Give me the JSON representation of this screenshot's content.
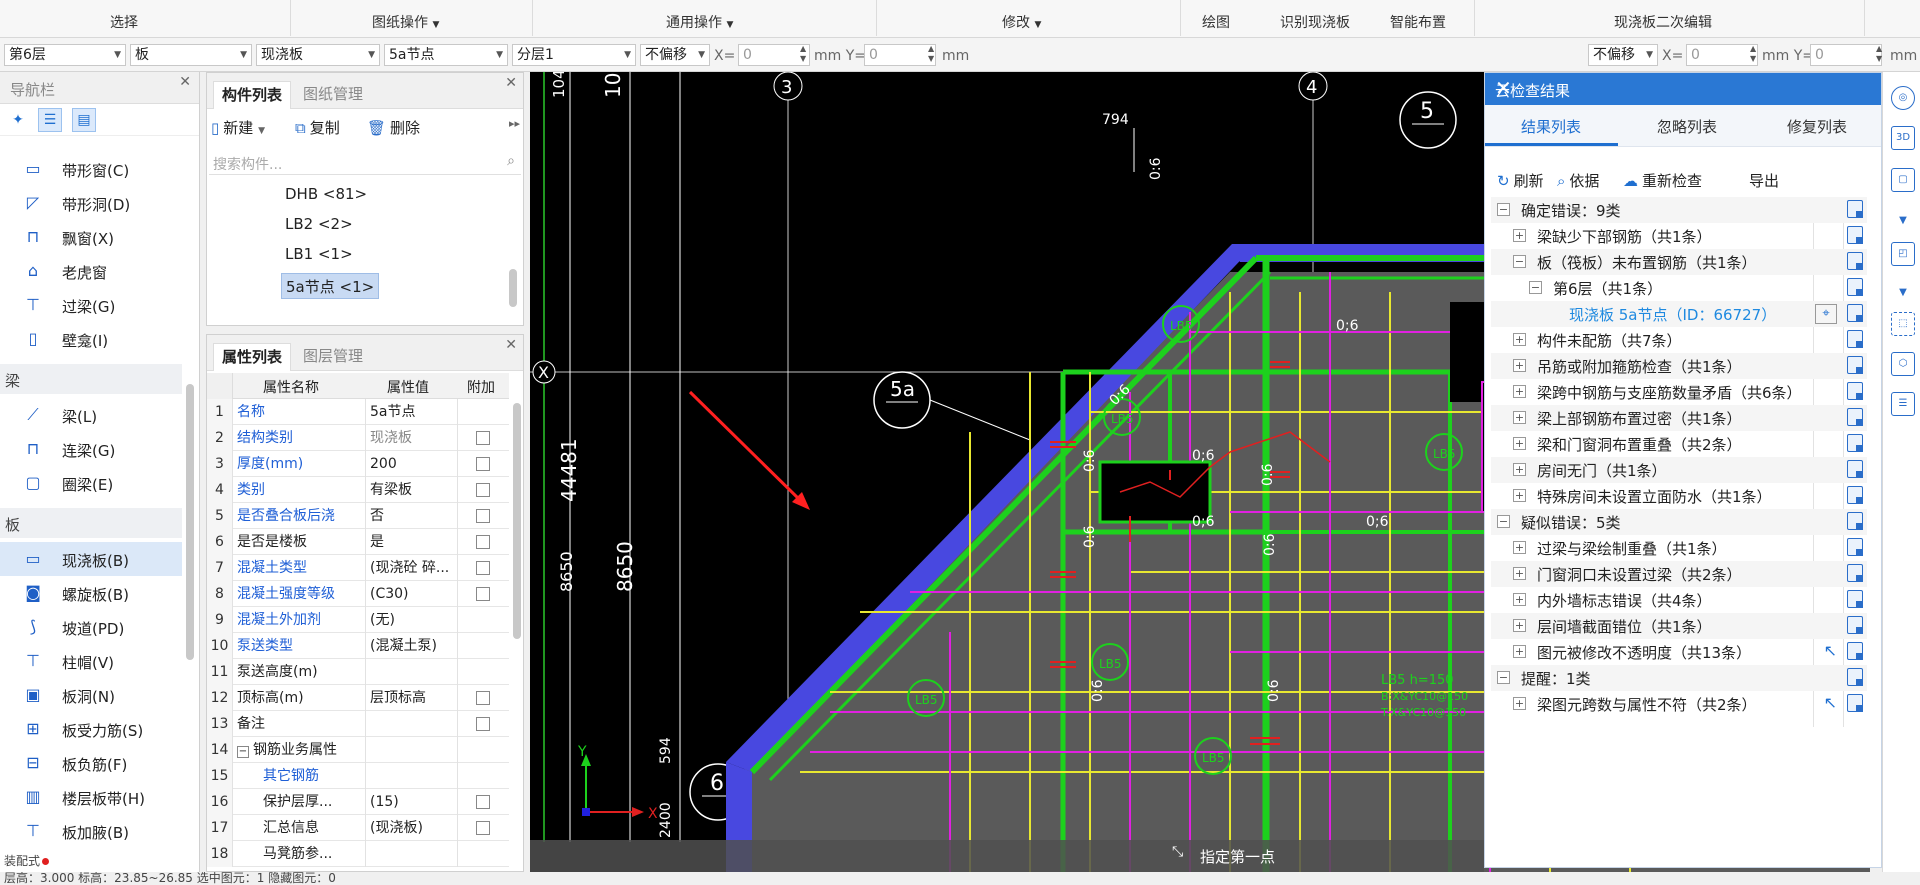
{
  "ribbon": {
    "groups": [
      "选择",
      "图纸操作",
      "通用操作",
      "修改",
      "绘图",
      "识别现浇板",
      "智能布置",
      "现浇板二次编辑"
    ]
  },
  "toolbar2": {
    "floor": "第6层",
    "category": "板",
    "type": "现浇板",
    "component": "5a节点",
    "layer": "分层1",
    "offset_left": "不偏移",
    "x_label_left": "X=",
    "x_value_left": "0",
    "y_label_left": "mm Y=",
    "y_value_left": "0",
    "unit_left": "mm",
    "offset_right": "不偏移",
    "x_label_right": "X=",
    "x_value_right": "0",
    "y_label_right": "mm Y=",
    "y_value_right": "0",
    "unit_right": "mm"
  },
  "nav": {
    "title": "导航栏",
    "items_top": [
      {
        "label": "带形窗(C)",
        "icon": "strip-window-icon"
      },
      {
        "label": "带形洞(D)",
        "icon": "strip-hole-icon"
      },
      {
        "label": "飘窗(X)",
        "icon": "bay-window-icon"
      },
      {
        "label": "老虎窗",
        "icon": "dormer-icon"
      },
      {
        "label": "过梁(G)",
        "icon": "lintel-icon"
      },
      {
        "label": "壁龛(I)",
        "icon": "niche-icon"
      }
    ],
    "cat_beam": "梁",
    "items_beam": [
      {
        "label": "梁(L)",
        "icon": "beam-icon"
      },
      {
        "label": "连梁(G)",
        "icon": "link-beam-icon"
      },
      {
        "label": "圈梁(E)",
        "icon": "ring-beam-icon"
      }
    ],
    "cat_slab": "板",
    "items_slab": [
      {
        "label": "现浇板(B)",
        "icon": "cast-slab-icon"
      },
      {
        "label": "螺旋板(B)",
        "icon": "spiral-slab-icon"
      },
      {
        "label": "坡道(PD)",
        "icon": "ramp-icon"
      },
      {
        "label": "柱帽(V)",
        "icon": "column-cap-icon"
      },
      {
        "label": "板洞(N)",
        "icon": "slab-hole-icon"
      },
      {
        "label": "板受力筋(S)",
        "icon": "slab-rebar-icon"
      },
      {
        "label": "板负筋(F)",
        "icon": "neg-rebar-icon"
      },
      {
        "label": "楼层板带(H)",
        "icon": "slab-strip-icon"
      },
      {
        "label": "板加腋(B)",
        "icon": "slab-haunch-icon"
      }
    ],
    "bottom_label": "装配式"
  },
  "comp": {
    "tab_active": "构件列表",
    "tab_other": "图纸管理",
    "new_label": "新建",
    "copy_label": "复制",
    "delete_label": "删除",
    "search_placeholder": "搜索构件...",
    "items": [
      "DHB <81>",
      "LB2 <2>",
      "LB1 <1>",
      "5a节点 <1>"
    ]
  },
  "prop": {
    "tab_active": "属性列表",
    "tab_other": "图层管理",
    "col_name": "属性名称",
    "col_value": "属性值",
    "col_extra": "附加",
    "rows": [
      {
        "n": "1",
        "k": "名称",
        "v": "5a节点"
      },
      {
        "n": "2",
        "k": "结构类别",
        "v": "现浇板"
      },
      {
        "n": "3",
        "k": "厚度(mm)",
        "v": "200"
      },
      {
        "n": "4",
        "k": "类别",
        "v": "有梁板"
      },
      {
        "n": "5",
        "k": "是否叠合板后浇",
        "v": "否"
      },
      {
        "n": "6",
        "k": "是否是楼板",
        "v": "是"
      },
      {
        "n": "7",
        "k": "混凝土类型",
        "v": "(现浇砼 碎..."
      },
      {
        "n": "8",
        "k": "混凝土强度等级",
        "v": "(C30)"
      },
      {
        "n": "9",
        "k": "混凝土外加剂",
        "v": "(无)"
      },
      {
        "n": "10",
        "k": "泵送类型",
        "v": "(混凝土泵)"
      },
      {
        "n": "11",
        "k": "泵送高度(m)",
        "v": ""
      },
      {
        "n": "12",
        "k": "顶标高(m)",
        "v": "层顶标高"
      },
      {
        "n": "13",
        "k": "备注",
        "v": ""
      },
      {
        "n": "14",
        "k": "钢筋业务属性",
        "v": ""
      },
      {
        "n": "15",
        "k": "其它钢筋",
        "v": ""
      },
      {
        "n": "16",
        "k": "保护层厚...",
        "v": "(15)"
      },
      {
        "n": "17",
        "k": "汇总信息",
        "v": "(现浇板)"
      },
      {
        "n": "18",
        "k": "马凳筋参...",
        "v": ""
      }
    ]
  },
  "canvas": {
    "axis_labels": [
      "3",
      "4",
      "5",
      "5a",
      "6",
      "X"
    ],
    "dims": [
      "44481",
      "8650",
      "8650",
      "594",
      "2400",
      "104",
      "10",
      "794"
    ],
    "slab_labels": [
      "LB5",
      "LB5",
      "LB5",
      "LB5",
      "LB5",
      "LB5",
      "LB5"
    ],
    "ratio": "0:6",
    "slab_note": "LB5 h=150",
    "slab_note2": "B:X&YC10@150",
    "slab_note3": "T:X&YC10@150",
    "status_text": "指定第一点"
  },
  "cloud": {
    "title": "云检查结果",
    "tabs": [
      "结果列表",
      "忽略列表",
      "修复列表"
    ],
    "tools": [
      "刷新",
      "依据",
      "重新检查",
      "导出"
    ],
    "rows": [
      {
        "level": 0,
        "toggle": "−",
        "text": "确定错误：9类"
      },
      {
        "level": 1,
        "toggle": "+",
        "text": "梁缺少下部钢筋（共1条）"
      },
      {
        "level": 1,
        "toggle": "−",
        "text": "板（筏板）未布置钢筋（共1条）"
      },
      {
        "level": 2,
        "toggle": "−",
        "text": "第6层（共1条）"
      },
      {
        "level": 3,
        "toggle": "",
        "text": "现浇板 5a节点（ID：66727）"
      },
      {
        "level": 1,
        "toggle": "+",
        "text": "构件未配筋（共7条）"
      },
      {
        "level": 1,
        "toggle": "+",
        "text": "吊筋或附加箍筋检查（共1条）"
      },
      {
        "level": 1,
        "toggle": "+",
        "text": "梁跨中钢筋与支座筋数量矛盾（共6条）"
      },
      {
        "level": 1,
        "toggle": "+",
        "text": "梁上部钢筋布置过密（共1条）"
      },
      {
        "level": 1,
        "toggle": "+",
        "text": "梁和门窗洞布置重叠（共2条）"
      },
      {
        "level": 1,
        "toggle": "+",
        "text": "房间无门（共1条）"
      },
      {
        "level": 1,
        "toggle": "+",
        "text": "特殊房间未设置立面防水（共1条）"
      },
      {
        "level": 0,
        "toggle": "−",
        "text": "疑似错误：5类"
      },
      {
        "level": 1,
        "toggle": "+",
        "text": "过梁与梁绘制重叠（共1条）"
      },
      {
        "level": 1,
        "toggle": "+",
        "text": "门窗洞口未设置过梁（共2条）"
      },
      {
        "level": 1,
        "toggle": "+",
        "text": "内外墙标志错误（共4条）"
      },
      {
        "level": 1,
        "toggle": "+",
        "text": "层间墙截面错位（共1条）"
      },
      {
        "level": 1,
        "toggle": "+",
        "text": "图元被修改不透明度（共13条）"
      },
      {
        "level": 0,
        "toggle": "−",
        "text": "提醒：1类"
      },
      {
        "level": 1,
        "toggle": "+",
        "text": "梁图元跨数与属性不符（共2条）"
      }
    ]
  },
  "status": {
    "left": "层高：3.000   标高：23.85~26.85   选中图元：1   隐藏图元：0"
  },
  "colors": {
    "accent": "#2a78d4",
    "canvas_bg": "#000000",
    "slab_fill": "#5a5a5a",
    "beam_green": "#1dd11d",
    "wall_yellow": "#e8e830",
    "magenta": "#e020e0",
    "blue_band": "#4848e0"
  }
}
